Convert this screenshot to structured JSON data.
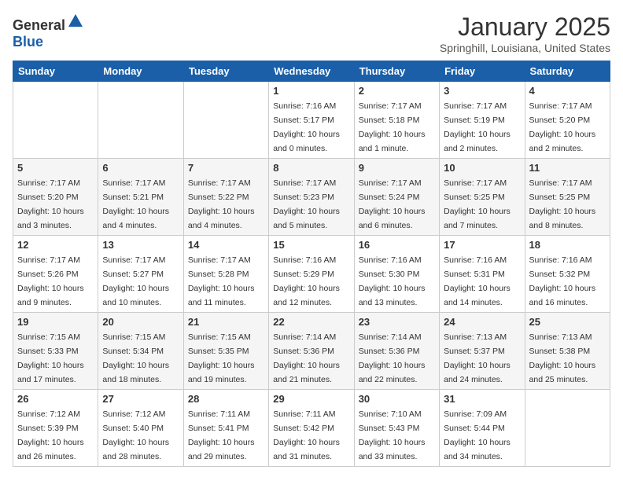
{
  "logo": {
    "text_general": "General",
    "text_blue": "Blue"
  },
  "header": {
    "month": "January 2025",
    "location": "Springhill, Louisiana, United States"
  },
  "weekdays": [
    "Sunday",
    "Monday",
    "Tuesday",
    "Wednesday",
    "Thursday",
    "Friday",
    "Saturday"
  ],
  "weeks": [
    [
      {
        "day": "",
        "sunrise": "",
        "sunset": "",
        "daylight": ""
      },
      {
        "day": "",
        "sunrise": "",
        "sunset": "",
        "daylight": ""
      },
      {
        "day": "",
        "sunrise": "",
        "sunset": "",
        "daylight": ""
      },
      {
        "day": "1",
        "sunrise": "Sunrise: 7:16 AM",
        "sunset": "Sunset: 5:17 PM",
        "daylight": "Daylight: 10 hours and 0 minutes."
      },
      {
        "day": "2",
        "sunrise": "Sunrise: 7:17 AM",
        "sunset": "Sunset: 5:18 PM",
        "daylight": "Daylight: 10 hours and 1 minute."
      },
      {
        "day": "3",
        "sunrise": "Sunrise: 7:17 AM",
        "sunset": "Sunset: 5:19 PM",
        "daylight": "Daylight: 10 hours and 2 minutes."
      },
      {
        "day": "4",
        "sunrise": "Sunrise: 7:17 AM",
        "sunset": "Sunset: 5:20 PM",
        "daylight": "Daylight: 10 hours and 2 minutes."
      }
    ],
    [
      {
        "day": "5",
        "sunrise": "Sunrise: 7:17 AM",
        "sunset": "Sunset: 5:20 PM",
        "daylight": "Daylight: 10 hours and 3 minutes."
      },
      {
        "day": "6",
        "sunrise": "Sunrise: 7:17 AM",
        "sunset": "Sunset: 5:21 PM",
        "daylight": "Daylight: 10 hours and 4 minutes."
      },
      {
        "day": "7",
        "sunrise": "Sunrise: 7:17 AM",
        "sunset": "Sunset: 5:22 PM",
        "daylight": "Daylight: 10 hours and 4 minutes."
      },
      {
        "day": "8",
        "sunrise": "Sunrise: 7:17 AM",
        "sunset": "Sunset: 5:23 PM",
        "daylight": "Daylight: 10 hours and 5 minutes."
      },
      {
        "day": "9",
        "sunrise": "Sunrise: 7:17 AM",
        "sunset": "Sunset: 5:24 PM",
        "daylight": "Daylight: 10 hours and 6 minutes."
      },
      {
        "day": "10",
        "sunrise": "Sunrise: 7:17 AM",
        "sunset": "Sunset: 5:25 PM",
        "daylight": "Daylight: 10 hours and 7 minutes."
      },
      {
        "day": "11",
        "sunrise": "Sunrise: 7:17 AM",
        "sunset": "Sunset: 5:25 PM",
        "daylight": "Daylight: 10 hours and 8 minutes."
      }
    ],
    [
      {
        "day": "12",
        "sunrise": "Sunrise: 7:17 AM",
        "sunset": "Sunset: 5:26 PM",
        "daylight": "Daylight: 10 hours and 9 minutes."
      },
      {
        "day": "13",
        "sunrise": "Sunrise: 7:17 AM",
        "sunset": "Sunset: 5:27 PM",
        "daylight": "Daylight: 10 hours and 10 minutes."
      },
      {
        "day": "14",
        "sunrise": "Sunrise: 7:17 AM",
        "sunset": "Sunset: 5:28 PM",
        "daylight": "Daylight: 10 hours and 11 minutes."
      },
      {
        "day": "15",
        "sunrise": "Sunrise: 7:16 AM",
        "sunset": "Sunset: 5:29 PM",
        "daylight": "Daylight: 10 hours and 12 minutes."
      },
      {
        "day": "16",
        "sunrise": "Sunrise: 7:16 AM",
        "sunset": "Sunset: 5:30 PM",
        "daylight": "Daylight: 10 hours and 13 minutes."
      },
      {
        "day": "17",
        "sunrise": "Sunrise: 7:16 AM",
        "sunset": "Sunset: 5:31 PM",
        "daylight": "Daylight: 10 hours and 14 minutes."
      },
      {
        "day": "18",
        "sunrise": "Sunrise: 7:16 AM",
        "sunset": "Sunset: 5:32 PM",
        "daylight": "Daylight: 10 hours and 16 minutes."
      }
    ],
    [
      {
        "day": "19",
        "sunrise": "Sunrise: 7:15 AM",
        "sunset": "Sunset: 5:33 PM",
        "daylight": "Daylight: 10 hours and 17 minutes."
      },
      {
        "day": "20",
        "sunrise": "Sunrise: 7:15 AM",
        "sunset": "Sunset: 5:34 PM",
        "daylight": "Daylight: 10 hours and 18 minutes."
      },
      {
        "day": "21",
        "sunrise": "Sunrise: 7:15 AM",
        "sunset": "Sunset: 5:35 PM",
        "daylight": "Daylight: 10 hours and 19 minutes."
      },
      {
        "day": "22",
        "sunrise": "Sunrise: 7:14 AM",
        "sunset": "Sunset: 5:36 PM",
        "daylight": "Daylight: 10 hours and 21 minutes."
      },
      {
        "day": "23",
        "sunrise": "Sunrise: 7:14 AM",
        "sunset": "Sunset: 5:36 PM",
        "daylight": "Daylight: 10 hours and 22 minutes."
      },
      {
        "day": "24",
        "sunrise": "Sunrise: 7:13 AM",
        "sunset": "Sunset: 5:37 PM",
        "daylight": "Daylight: 10 hours and 24 minutes."
      },
      {
        "day": "25",
        "sunrise": "Sunrise: 7:13 AM",
        "sunset": "Sunset: 5:38 PM",
        "daylight": "Daylight: 10 hours and 25 minutes."
      }
    ],
    [
      {
        "day": "26",
        "sunrise": "Sunrise: 7:12 AM",
        "sunset": "Sunset: 5:39 PM",
        "daylight": "Daylight: 10 hours and 26 minutes."
      },
      {
        "day": "27",
        "sunrise": "Sunrise: 7:12 AM",
        "sunset": "Sunset: 5:40 PM",
        "daylight": "Daylight: 10 hours and 28 minutes."
      },
      {
        "day": "28",
        "sunrise": "Sunrise: 7:11 AM",
        "sunset": "Sunset: 5:41 PM",
        "daylight": "Daylight: 10 hours and 29 minutes."
      },
      {
        "day": "29",
        "sunrise": "Sunrise: 7:11 AM",
        "sunset": "Sunset: 5:42 PM",
        "daylight": "Daylight: 10 hours and 31 minutes."
      },
      {
        "day": "30",
        "sunrise": "Sunrise: 7:10 AM",
        "sunset": "Sunset: 5:43 PM",
        "daylight": "Daylight: 10 hours and 33 minutes."
      },
      {
        "day": "31",
        "sunrise": "Sunrise: 7:09 AM",
        "sunset": "Sunset: 5:44 PM",
        "daylight": "Daylight: 10 hours and 34 minutes."
      },
      {
        "day": "",
        "sunrise": "",
        "sunset": "",
        "daylight": ""
      }
    ]
  ]
}
